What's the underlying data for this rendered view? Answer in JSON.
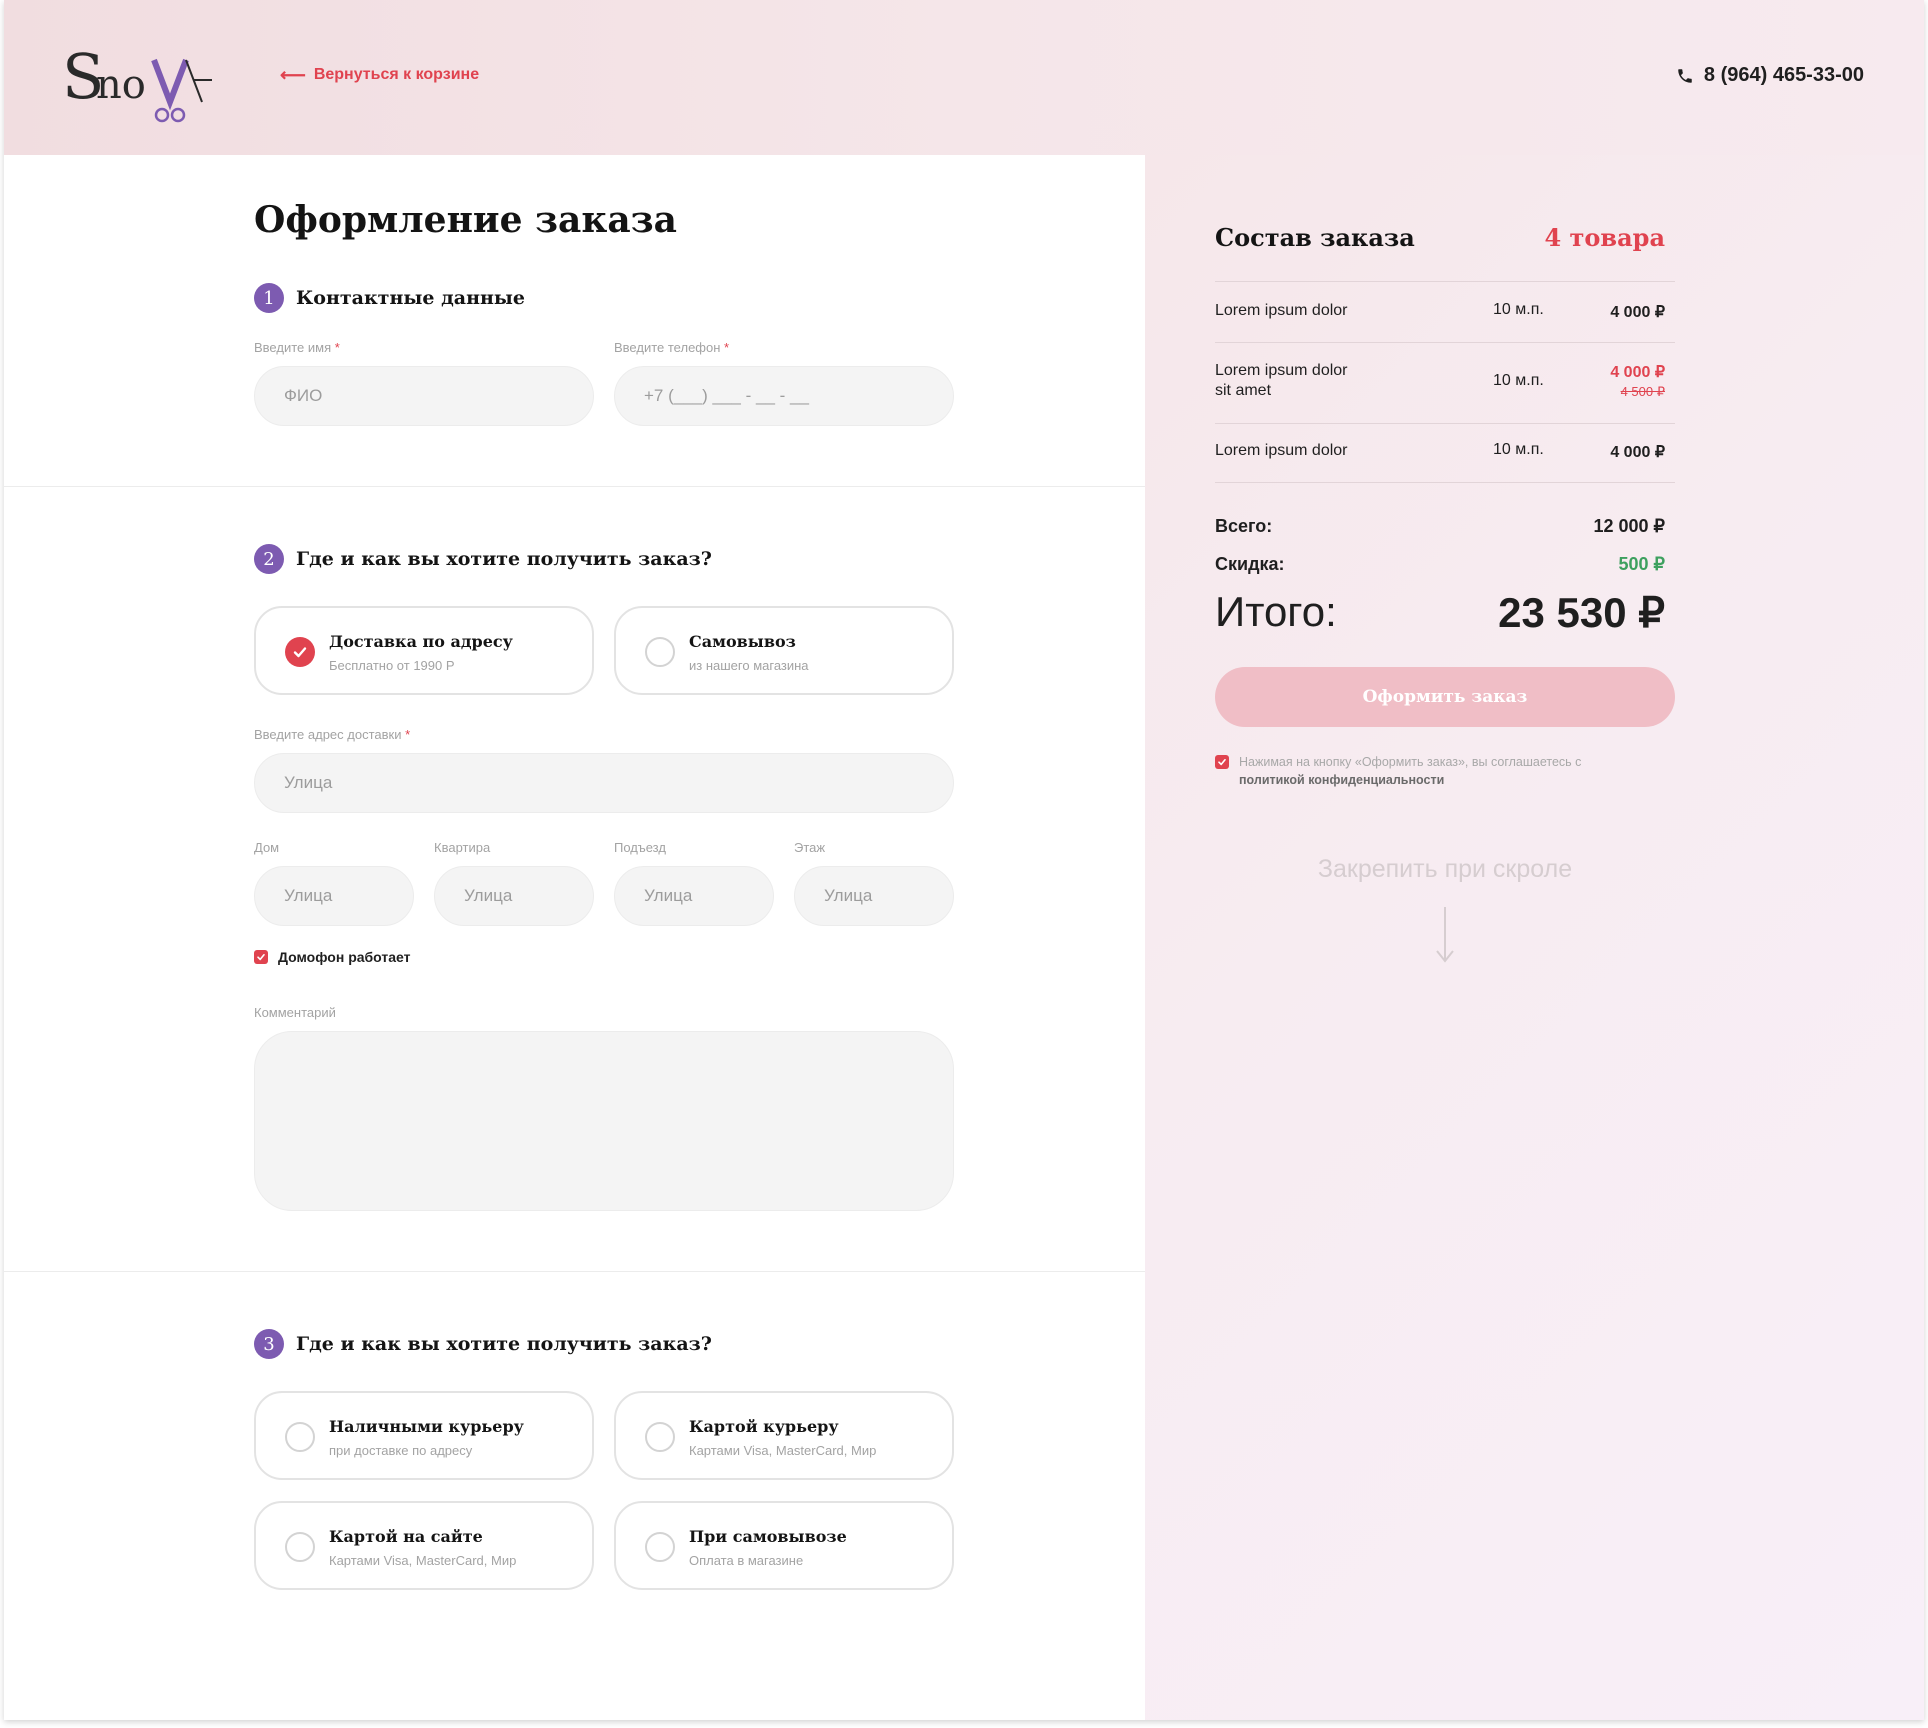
{
  "header": {
    "logo_text": "SNoYA",
    "back_link": "Вернуться к корзине",
    "phone": "8 (964) 465-33-00"
  },
  "checkout": {
    "title": "Оформление заказа",
    "section1": {
      "number": "1",
      "title": "Контактные данные",
      "name_label": "Введите имя",
      "name_placeholder": "ФИО",
      "phone_label": "Введите телефон",
      "phone_placeholder": "+7 (___) ___ - __ - __",
      "required_mark": "*"
    },
    "section2": {
      "number": "2",
      "title": "Где и как вы хотите получить заказ?",
      "options": [
        {
          "title": "Доставка по адресу",
          "subtitle": "Бесплатно от 1990 Р",
          "checked": true
        },
        {
          "title": "Самовывоз",
          "subtitle": "из нашего магазина",
          "checked": false
        }
      ],
      "address_label": "Введите адрес доставки",
      "address_placeholder": "Улица",
      "fields": [
        {
          "label": "Дом",
          "placeholder": "Улица"
        },
        {
          "label": "Квартира",
          "placeholder": "Улица"
        },
        {
          "label": "Подъезд",
          "placeholder": "Улица"
        },
        {
          "label": "Этаж",
          "placeholder": "Улица"
        }
      ],
      "intercom_label": "Домофон работает",
      "intercom_checked": true,
      "comment_label": "Комментарий"
    },
    "section3": {
      "number": "3",
      "title": "Где и как вы хотите получить заказ?",
      "options": [
        {
          "title": "Наличными курьеру",
          "subtitle": "при доставке по адресу",
          "checked": false
        },
        {
          "title": "Картой курьеру",
          "subtitle": "Картами Visa, MasterCard, Мир",
          "checked": false
        },
        {
          "title": "Картой на сайте",
          "subtitle": "Картами Visa, MasterCard, Мир",
          "checked": false
        },
        {
          "title": "При самовывозе",
          "subtitle": "Оплата в магазине",
          "checked": false
        }
      ]
    }
  },
  "summary": {
    "title": "Состав заказа",
    "count": "4 товара",
    "items": [
      {
        "name": "Lorem ipsum dolor",
        "name_line2": "",
        "qty": "10 м.п.",
        "price": "4 000 ₽",
        "old_price": ""
      },
      {
        "name": "Lorem ipsum dolor",
        "name_line2": "sit amet",
        "qty": "10 м.п.",
        "price": "4 000 ₽",
        "old_price": "4 500 ₽"
      },
      {
        "name": "Lorem ipsum dolor",
        "name_line2": "",
        "qty": "10 м.п.",
        "price": "4 000 ₽",
        "old_price": ""
      }
    ],
    "total_label": "Всего:",
    "total_value": "12 000 ₽",
    "discount_label": "Скидка:",
    "discount_value": "500 ₽",
    "grand_label": "Итого:",
    "grand_value": "23 530 ₽",
    "order_button": "Оформить заказ",
    "agree_text": "Нажимая на кнопку «Оформить заказ», вы соглашаетесь с",
    "agree_link": "политикой конфиденциальности",
    "pin_note": "Закрепить при скроле"
  },
  "colors": {
    "accent": "#e0434f",
    "step": "#7d5bb1",
    "discount": "#3ea05f",
    "button": "#f0bec6"
  },
  "icons": [
    "logo-scissors-icon",
    "arrow-left-icon",
    "phone-icon",
    "check-icon",
    "arrow-down-icon"
  ]
}
